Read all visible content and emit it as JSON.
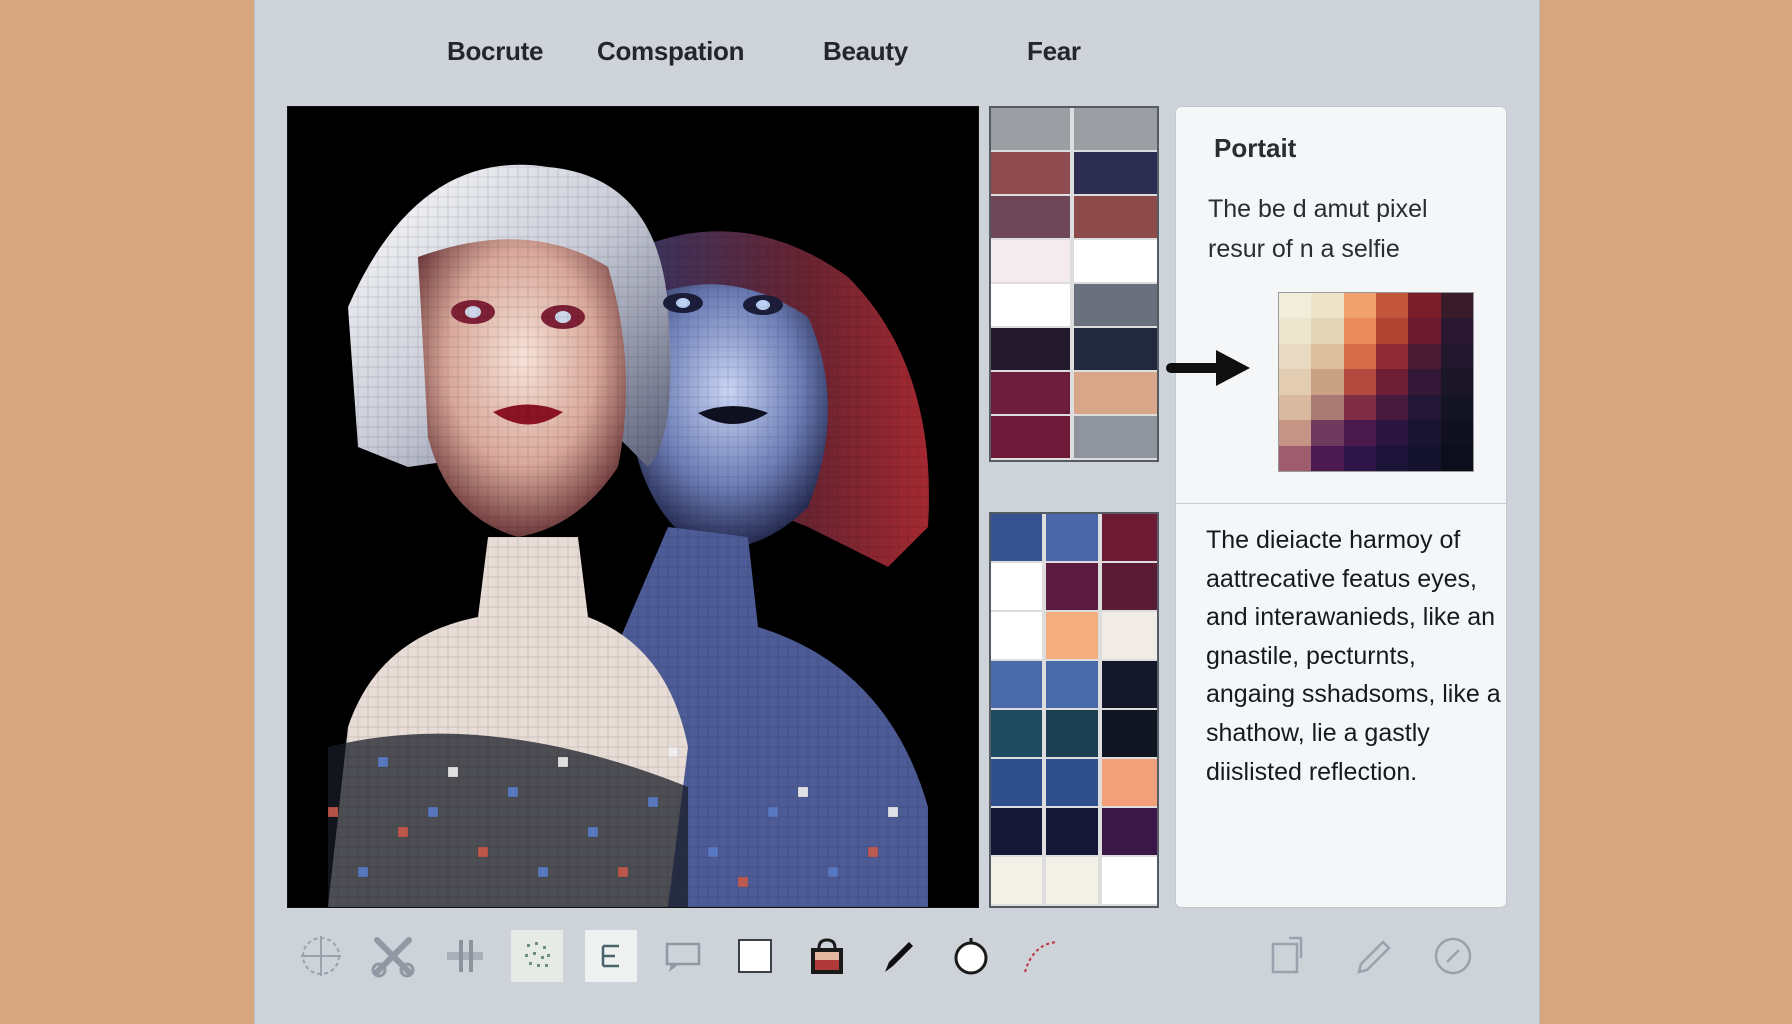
{
  "tabs": [
    {
      "label": "Bocrute"
    },
    {
      "label": "Comspation"
    },
    {
      "label": "Beauty"
    },
    {
      "label": "Fear"
    }
  ],
  "panel": {
    "title": "Portait",
    "description": "The be d amut pixel resur of n a selfie",
    "body": "The dieiacte harmoy of aattrecative featus eyes, and interawanieds, like an gnastile, pecturnts, angaing sshadsoms, like a shathow, lie a gastly diislisted reflection."
  },
  "swatches_top": [
    "#9b9ea2",
    "#9b9ea2",
    "#8f4c50",
    "#2d2d52",
    "#6d4757",
    "#8c4a4b",
    "#f4ebef",
    "#ffffff",
    "#ffffff",
    "#6a707d",
    "#221a2c",
    "#22283d",
    "#6c1d3b",
    "#d8a688",
    "#6e1b3a",
    "#8f949d"
  ],
  "swatches_bottom": [
    "#35538e",
    "#4a68a8",
    "#6d1a35",
    "#ffffff",
    "#5c1c40",
    "#5a1b34",
    "#ffffff",
    "#f4ad7c",
    "#f0ebe6",
    "#4a69a8",
    "#4a69a8",
    "#14162a",
    "#1e4b60",
    "#1c3f52",
    "#111522",
    "#2e4f8c",
    "#2e4f8c",
    "#f1a07a",
    "#141836",
    "#141836",
    "#3a1746",
    "#f3f1e7",
    "#f3f1e7",
    "#ffffff"
  ],
  "mini_palette": [
    [
      "#f1eedb",
      "#ede3c9",
      "#f0a16d",
      "#c3553a",
      "#7b1e2a",
      "#3a1b2a"
    ],
    [
      "#efe6d0",
      "#e6d6b8",
      "#eb8a5a",
      "#b04332",
      "#6b1a2f",
      "#2a1730"
    ],
    [
      "#e8dac2",
      "#dbbf9c",
      "#d66c4a",
      "#8f2b34",
      "#4a1932",
      "#20172c"
    ],
    [
      "#e2cdb2",
      "#c9a285",
      "#b34a3f",
      "#6e1f36",
      "#331838",
      "#1a1628"
    ],
    [
      "#d9b9a0",
      "#a97a74",
      "#7f2c45",
      "#481a3d",
      "#231738",
      "#141425"
    ],
    [
      "#c69484",
      "#6e3a5e",
      "#4a1a4c",
      "#2a1640",
      "#191432",
      "#101020"
    ],
    [
      "#9e5c6e",
      "#4a1a50",
      "#2e1648",
      "#1c1438",
      "#14122c",
      "#0d0e1c"
    ]
  ],
  "tools": [
    {
      "icon": "crosshair-icon"
    },
    {
      "icon": "scissors-icon"
    },
    {
      "icon": "split-icon"
    },
    {
      "icon": "noise-icon"
    },
    {
      "icon": "text-icon"
    },
    {
      "icon": "comment-icon"
    },
    {
      "icon": "square-icon"
    },
    {
      "icon": "bucket-icon"
    },
    {
      "icon": "pen-icon"
    },
    {
      "icon": "circle-icon"
    },
    {
      "icon": "curve-icon"
    },
    {
      "icon": "crop-icon"
    },
    {
      "icon": "pencil-icon"
    },
    {
      "icon": "compass-icon"
    }
  ],
  "colors": {
    "window_bg": "#cdd3d8",
    "page_bg": "#d7a57e",
    "panel_bg": "#f4f6f8"
  }
}
